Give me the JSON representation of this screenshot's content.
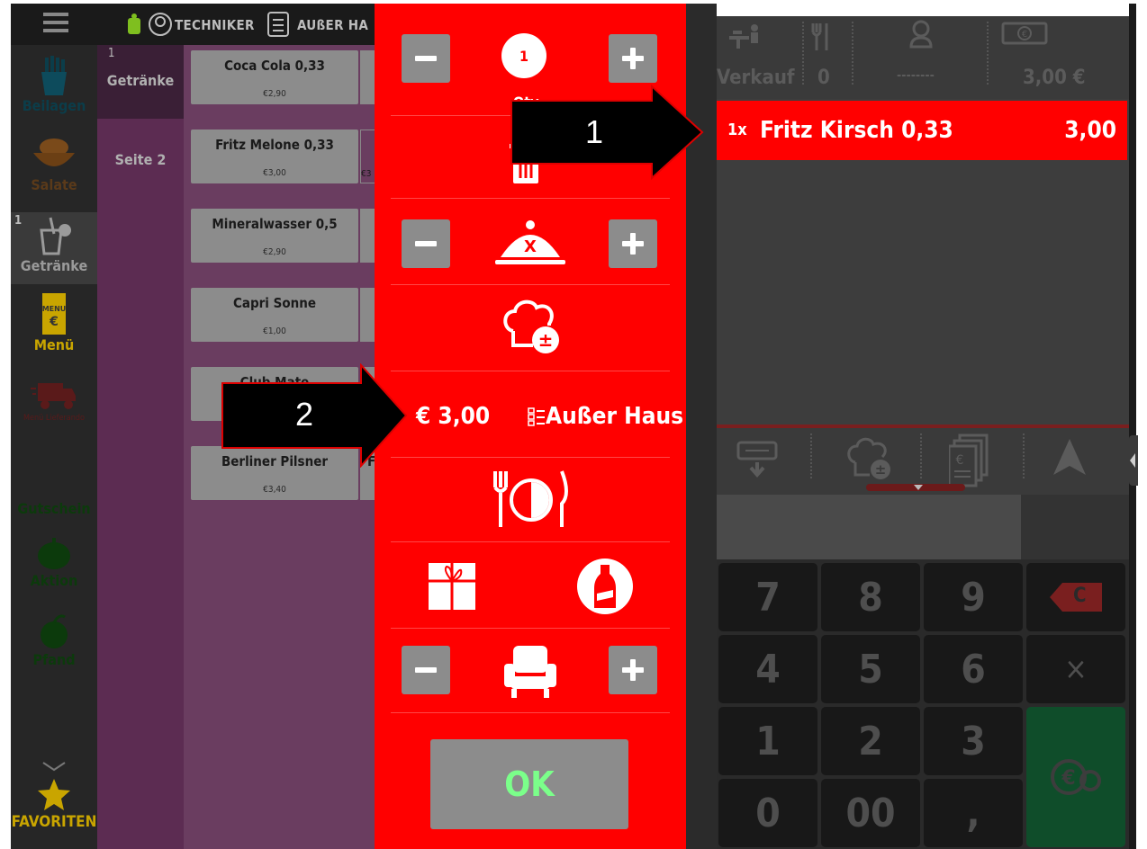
{
  "topbar": {
    "technician_label": "TECHNIKER",
    "order_type_label": "AUßER HA"
  },
  "categories": [
    {
      "label": "Beilagen",
      "icon": "fries-icon",
      "color": "#0b3d4a"
    },
    {
      "label": "Salate",
      "icon": "salad-bowl-icon",
      "color": "#5a3a1a"
    },
    {
      "label": "Getränke",
      "icon": "drink-glass-icon",
      "color": "#9a9a9a",
      "badge": "1",
      "active": true
    },
    {
      "label": "Menü",
      "icon": "menu-card-icon",
      "color": "#c9a500"
    },
    {
      "label": "Menü Lieferando",
      "icon": "delivery-truck-icon",
      "color": "#5a1a1a"
    },
    {
      "label": "Gutschein",
      "icon": "voucher-icon",
      "color": "#0c3a0c"
    },
    {
      "label": "Aktion",
      "icon": "pumpkin-icon",
      "color": "#0c3a0c"
    },
    {
      "label": "Pfand",
      "icon": "apple-icon",
      "color": "#0c3a0c"
    },
    {
      "label": "FAVORITEN",
      "icon": "star-icon",
      "color": "#c9a500"
    }
  ],
  "subgroups": [
    {
      "label": "Getränke",
      "badge": "1",
      "active": true
    },
    {
      "label": "Seite 2"
    }
  ],
  "products": [
    {
      "name": "Coca Cola 0,33",
      "price": "€2,90"
    },
    {
      "name": "Fritz Melone 0,33",
      "price": "€3,00"
    },
    {
      "name": "Mineralwasser 0,5",
      "price": "€2,90"
    },
    {
      "name": "Capri Sonne",
      "price": "€1,00"
    },
    {
      "name": "Club Mate",
      "price": ""
    },
    {
      "name": "Berliner Pilsner",
      "price": "€3,40"
    }
  ],
  "product_fragments": {
    "col2_row2_price": "€3",
    "col2_row6_name": "F"
  },
  "modal": {
    "qty_badge": "1",
    "qty_label": "Qty",
    "price": "€ 3,00",
    "order_type": "Außer Haus",
    "ok_label": "OK"
  },
  "order_panel": {
    "mode_label": "Verkauf",
    "covers_value": "0",
    "guest_value": "--------",
    "total": "3,00 €",
    "lines": [
      {
        "qty": "1x",
        "name": "Fritz Kirsch 0,33",
        "amount": "3,00"
      }
    ]
  },
  "keypad": {
    "keys": [
      "7",
      "8",
      "9",
      "4",
      "5",
      "6",
      "1",
      "2",
      "3",
      "0",
      "00",
      ","
    ],
    "clear_label": "C",
    "multiply_label": "×"
  },
  "callouts": [
    {
      "label": "1"
    },
    {
      "label": "2"
    }
  ],
  "colors": {
    "modal_red": "#ff0000",
    "ok_text_green": "#7bff8a",
    "pay_button_green": "#0f6b3a",
    "subgroup_purple": "#5c2c52"
  }
}
